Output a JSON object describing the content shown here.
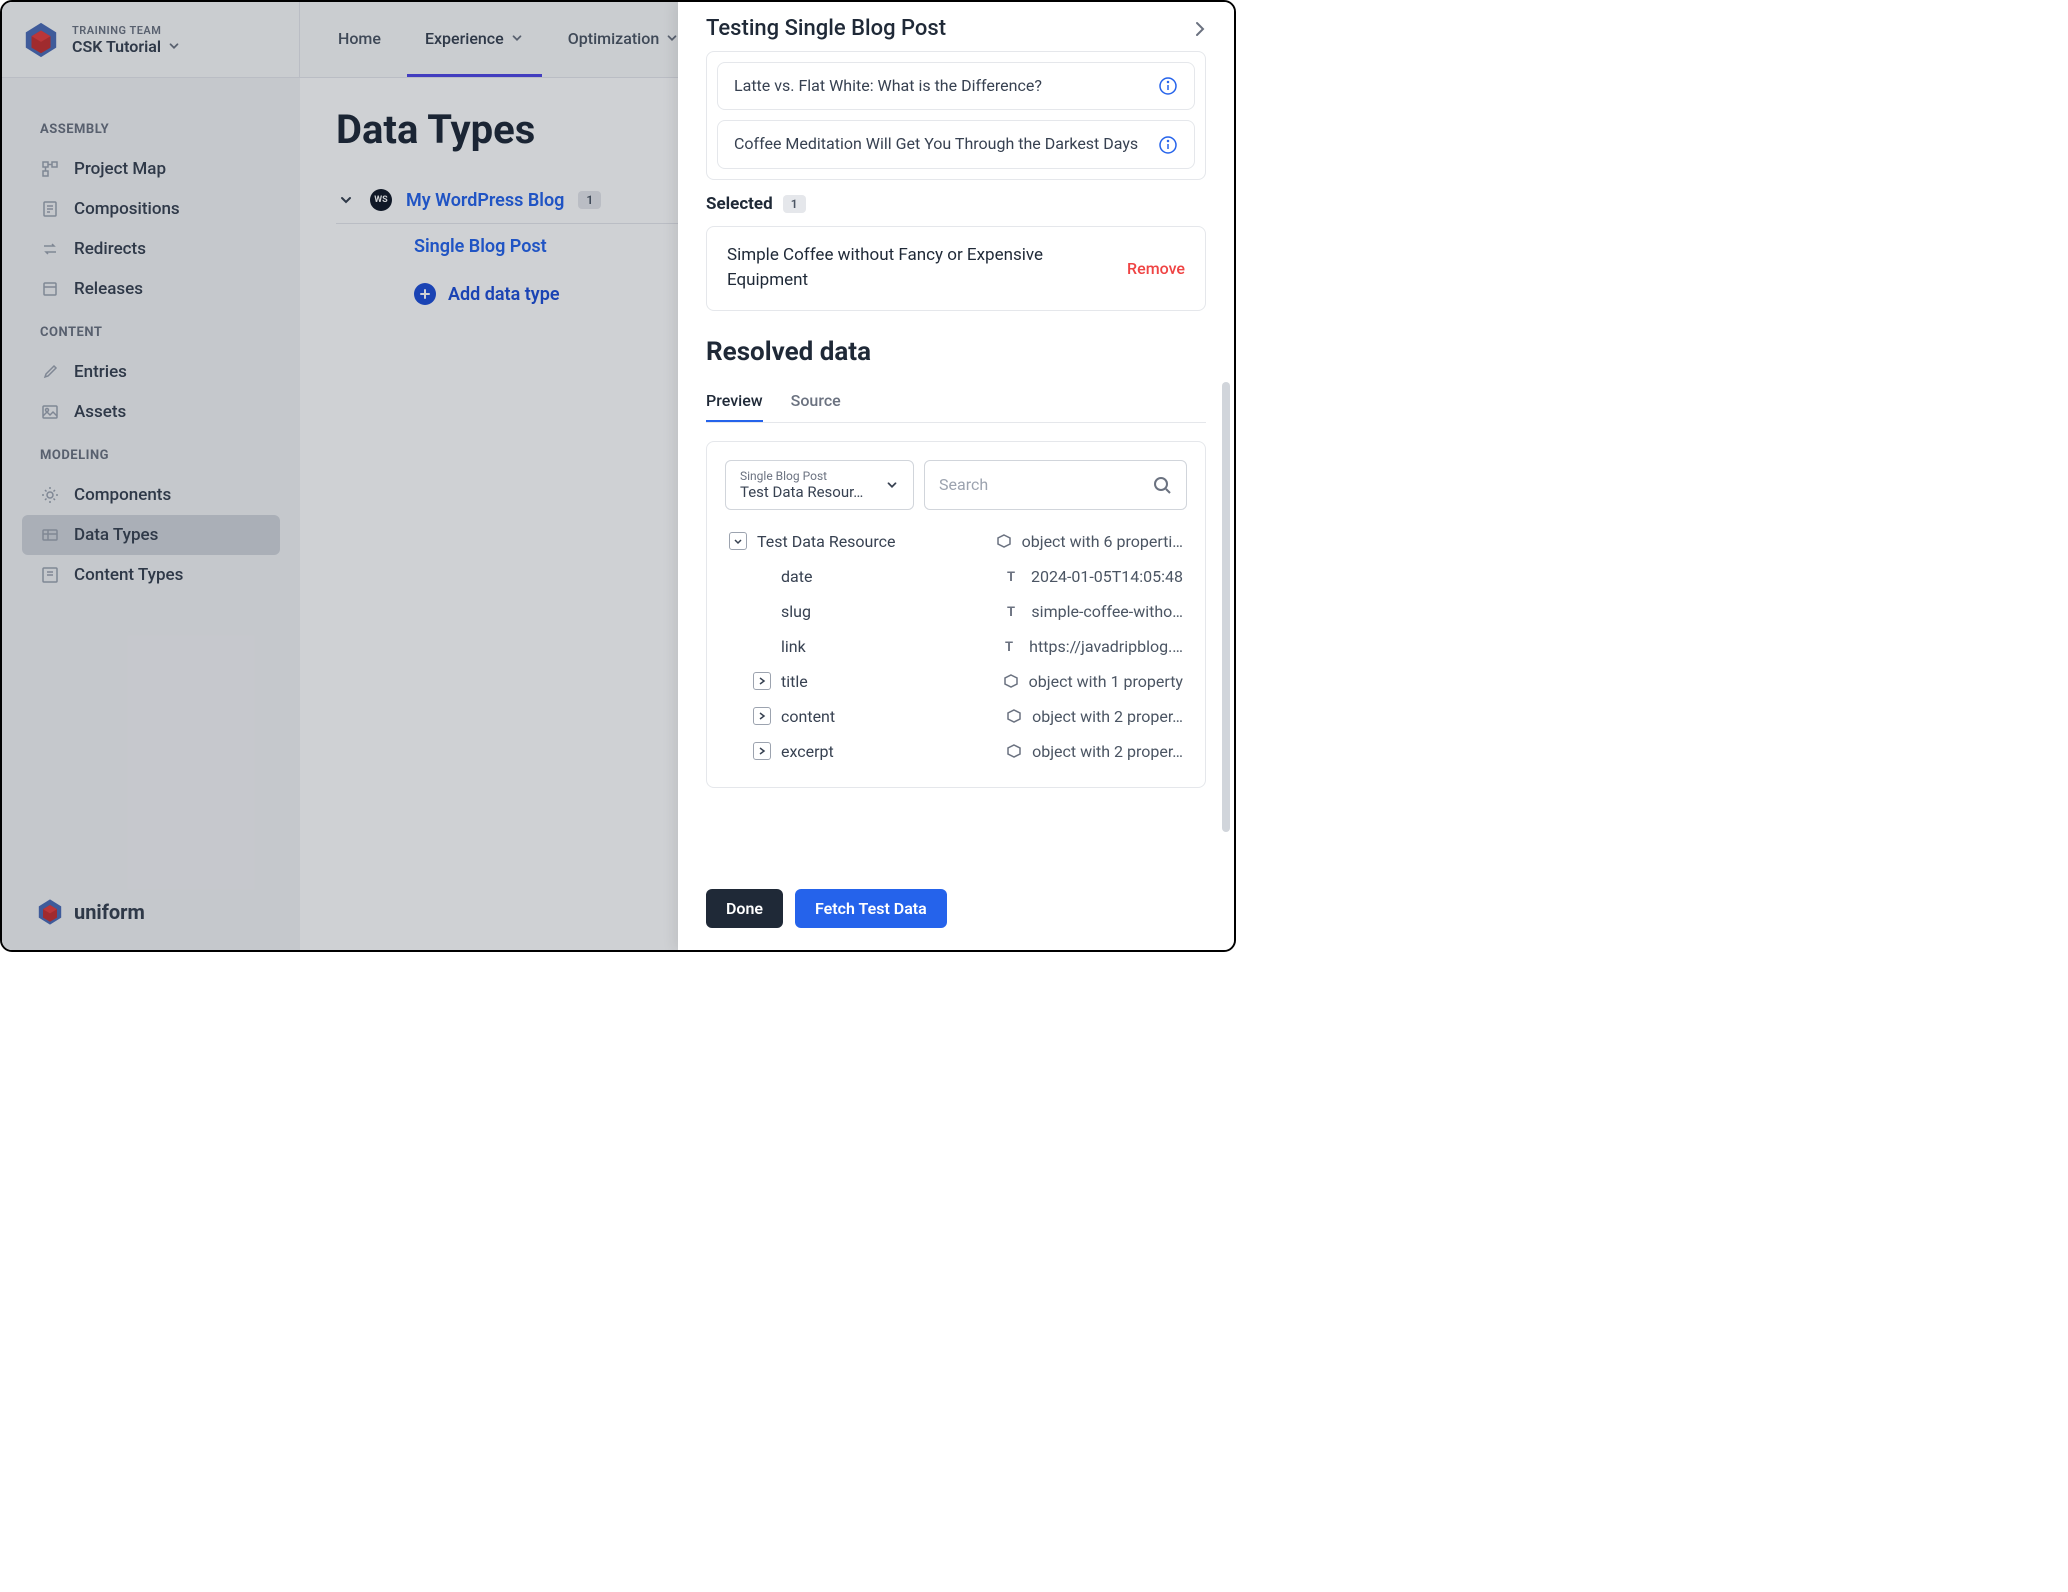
{
  "header": {
    "team": "TRAINING TEAM",
    "project": "CSK Tutorial",
    "nav": [
      {
        "label": "Home",
        "dropdown": false
      },
      {
        "label": "Experience",
        "dropdown": true,
        "active": true
      },
      {
        "label": "Optimization",
        "dropdown": true
      }
    ]
  },
  "sidebar": {
    "sections": {
      "assembly": {
        "title": "ASSEMBLY",
        "items": [
          "Project Map",
          "Compositions",
          "Redirects",
          "Releases"
        ]
      },
      "content": {
        "title": "CONTENT",
        "items": [
          "Entries",
          "Assets"
        ]
      },
      "modeling": {
        "title": "MODELING",
        "items": [
          "Components",
          "Data Types",
          "Content Types"
        ]
      }
    },
    "footer_brand": "uniform"
  },
  "main": {
    "page_title": "Data Types",
    "source_badge": "WS",
    "source_name": "My WordPress Blog",
    "source_count": "1",
    "child_type": "Single Blog Post",
    "add_label": "Add data type"
  },
  "drawer": {
    "title": "Testing Single Blog Post",
    "suggestion_items": [
      "Latte vs. Flat White: What is the Difference?",
      "Coffee Meditation Will Get You Through the Darkest Days"
    ],
    "selected_label": "Selected",
    "selected_count": "1",
    "selected_item": "Simple Coffee without Fancy or Expensive Equipment",
    "remove_label": "Remove",
    "resolved_title": "Resolved data",
    "tabs": {
      "preview": "Preview",
      "source": "Source"
    },
    "dropdown": {
      "label": "Single Blog Post",
      "value": "Test Data Resour…"
    },
    "search_placeholder": "Search",
    "tree": {
      "root": {
        "name": "Test Data Resource",
        "value": "object with 6 properti…",
        "type": "object"
      },
      "rows": [
        {
          "name": "date",
          "value": "2024-01-05T14:05:48",
          "type": "text"
        },
        {
          "name": "slug",
          "value": "simple-coffee-witho…",
          "type": "text"
        },
        {
          "name": "link",
          "value": "https://javadripblog.…",
          "type": "text"
        },
        {
          "name": "title",
          "value": "object with 1 property",
          "type": "object",
          "expandable": true
        },
        {
          "name": "content",
          "value": "object with 2 proper…",
          "type": "object",
          "expandable": true
        },
        {
          "name": "excerpt",
          "value": "object with 2 proper…",
          "type": "object",
          "expandable": true
        }
      ]
    },
    "footer": {
      "done": "Done",
      "fetch": "Fetch Test Data"
    }
  }
}
